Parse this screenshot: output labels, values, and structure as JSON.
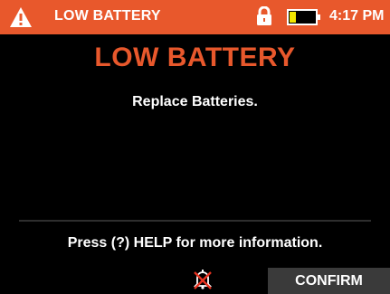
{
  "header": {
    "background_color": "#e8582c",
    "alert_icon": "warning-triangle-icon",
    "title": "LOW BATTERY",
    "lock_icon": "padlock-icon",
    "battery_icon": "battery-low-icon",
    "battery_level_color": "#f2e600",
    "time": "4:17 PM"
  },
  "main": {
    "title": "LOW BATTERY",
    "title_color": "#e8582c",
    "message": "Replace Batteries.",
    "help_text": "Press (?) HELP for more information."
  },
  "footer": {
    "mute_icon": "alarm-muted-icon",
    "confirm_label": "CONFIRM"
  }
}
